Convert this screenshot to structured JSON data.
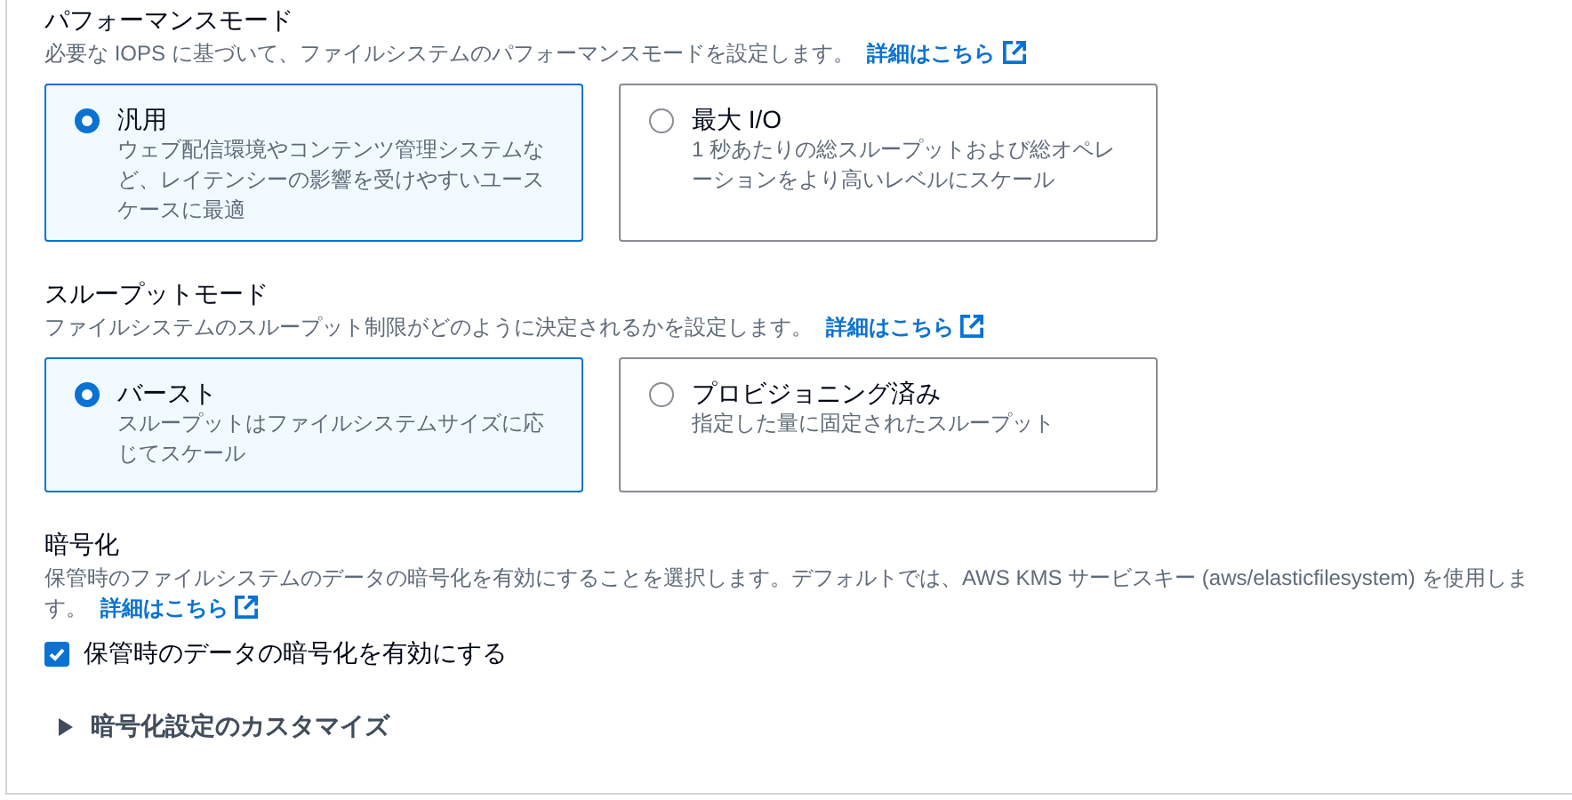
{
  "sections": [
    {
      "kind": "radio",
      "title": "パフォーマンスモード",
      "description": "必要な IOPS に基づいて、ファイルシステムのパフォーマンスモードを設定します。",
      "link": "詳細はこちら",
      "options": [
        {
          "label": "汎用",
          "description": "ウェブ配信環境やコンテンツ管理システムなど、レイテンシーの影響を受けやすいユースケースに最適",
          "selected": true
        },
        {
          "label": "最大 I/O",
          "description": "1 秒あたりの総スループットおよび総オペレーションをより高いレベルにスケール",
          "selected": false
        }
      ]
    },
    {
      "kind": "radio",
      "title": "スループットモード",
      "description": "ファイルシステムのスループット制限がどのように決定されるかを設定します。",
      "link": "詳細はこちら",
      "options": [
        {
          "label": "バースト",
          "description": "スループットはファイルシステムサイズに応じてスケール",
          "selected": true
        },
        {
          "label": "プロビジョニング済み",
          "description": "指定した量に固定されたスループット",
          "selected": false
        }
      ]
    },
    {
      "kind": "checkbox",
      "title": "暗号化",
      "description": "保管時のファイルシステムのデータの暗号化を有効にすることを選択します。デフォルトでは、AWS KMS サービスキー (aws/elasticfilesystem) を使用します。",
      "link": "詳細はこちら",
      "checkbox": {
        "label": "保管時のデータの暗号化を有効にする",
        "checked": true
      },
      "expander": {
        "label": "暗号化設定のカスタマイズ",
        "expanded": false
      }
    }
  ]
}
